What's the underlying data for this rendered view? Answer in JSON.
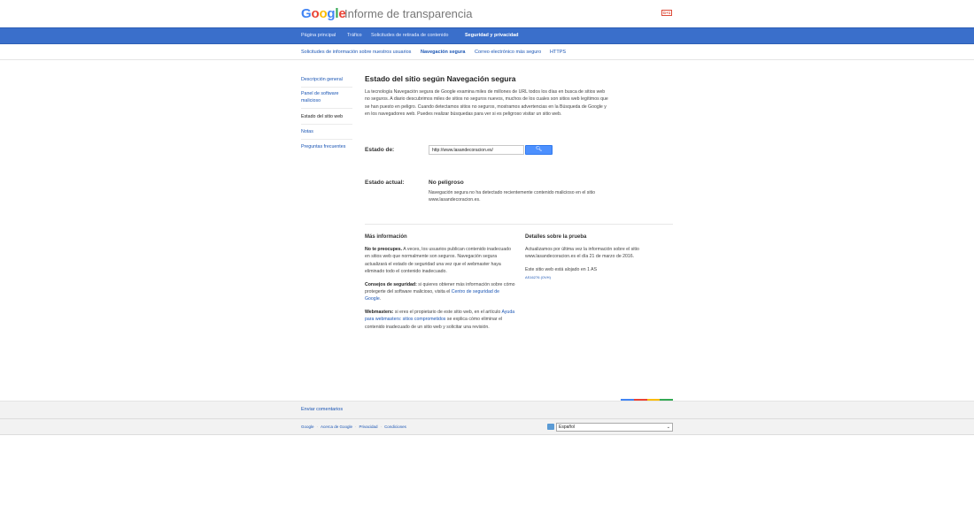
{
  "header": {
    "logo_text": [
      "G",
      "o",
      "o",
      "g",
      "l",
      "e"
    ],
    "product_name": "Informe de transparencia",
    "gplus_label": "G+1"
  },
  "nav": {
    "items": [
      {
        "label": "Página principal",
        "active": false
      },
      {
        "label": "Tráfico",
        "active": false
      },
      {
        "label": "Solicitudes de retirada de contenido",
        "active": false
      },
      {
        "label": "Seguridad y privacidad",
        "active": true
      }
    ]
  },
  "subnav": {
    "items": [
      {
        "label": "Solicitudes de información sobre nuestros usuarios",
        "active": false
      },
      {
        "label": "Navegación segura",
        "active": true
      },
      {
        "label": "Correo electrónico más seguro",
        "active": false
      },
      {
        "label": "HTTPS",
        "active": false
      }
    ]
  },
  "sidebar": {
    "items": [
      {
        "label": "Descripción general",
        "active": false
      },
      {
        "label": "Panel de software malicioso",
        "active": false
      },
      {
        "label": "Estado del sitio web",
        "active": true
      },
      {
        "label": "Notas",
        "active": false
      },
      {
        "label": "Preguntas frecuentes",
        "active": false
      }
    ]
  },
  "main": {
    "title": "Estado del sitio según Navegación segura",
    "intro": "La tecnología Navegación segura de Google examina miles de millones de URL todos los días en busca de sitios web no seguros. A diario descubrimos miles de sitios no seguros nuevos, muchos de los cuales son sitios web legítimos que se han puesto en peligro. Cuando detectamos sitios no seguros, mostramos advertencias en la Búsqueda de Google y en los navegadores web. Puedes realizar búsquedas para ver si es peligroso visitar un sitio web.",
    "estado_label": "Estado de:",
    "url_value": "http://www.lasandecoracion.es/",
    "actual_label": "Estado actual:",
    "status_value": "No peligroso",
    "status_desc": "Navegación segura no ha detectado recientemente contenido malicioso en el sitio www.lasandecoracion.es."
  },
  "mas_info": {
    "title": "Más información",
    "p1_bold": "No te preocupes.",
    "p1_text": " A veces, los usuarios publican contenido inadecuado en sitios web que normalmente son seguros. Navegación segura actualizará el estado de seguridad una vez que el webmaster haya eliminado todo el contenido inadecuado.",
    "p2_bold": "Consejos de seguridad:",
    "p2_text": " si quieres obtener más información sobre cómo protegerte del software malicioso, visita el ",
    "p2_link": "Centro de seguridad de Google",
    "p2_end": ".",
    "p3_bold": "Webmasters:",
    "p3_text": " si eres el propietario de este sitio web, en el artículo ",
    "p3_link": "Ayuda para webmasters: sitios comprometidos",
    "p3_end": " se explica cómo eliminar el contenido inadecuado de un sitio web y solicitar una revisión."
  },
  "detalles": {
    "title": "Detalles sobre la prueba",
    "p1": "Actualizamos por última vez la información sobre el sitio www.lasandecoracion.es el día 21 de marzo de 2016.",
    "p2": "Este sitio web está alojado en 1 AS",
    "asn": "AS16276 (OVH)"
  },
  "footer": {
    "feedback": "Enviar comentarios",
    "links": [
      "Google",
      "Acerca de Google",
      "Privacidad",
      "Condiciones"
    ],
    "language": "Español",
    "colorbar": [
      "#4285f4",
      "#ea4335",
      "#fbbc05",
      "#34a853"
    ]
  }
}
